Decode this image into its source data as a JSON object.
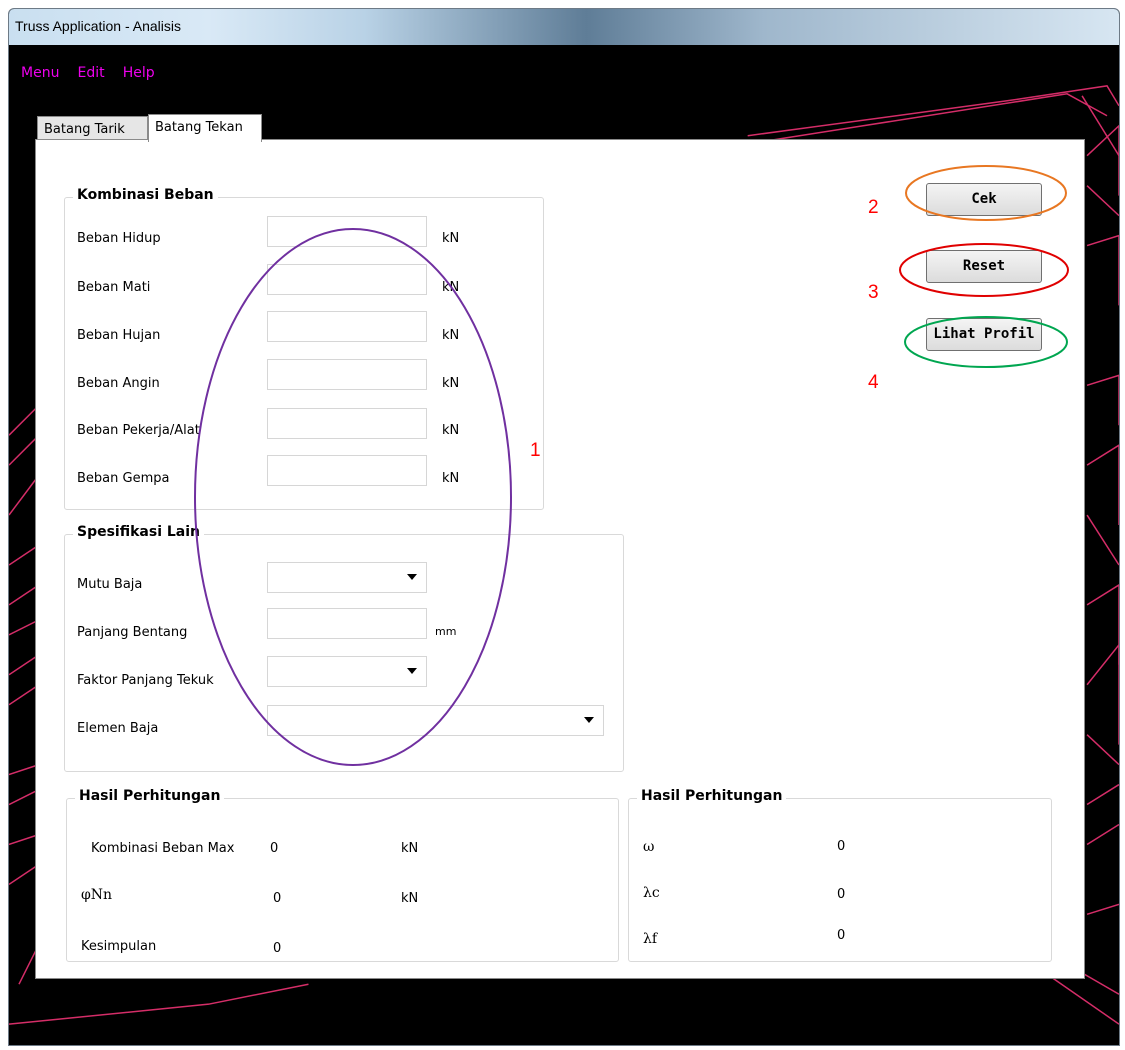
{
  "window": {
    "title": "Truss Application - Analisis"
  },
  "menu": [
    "Menu",
    "Edit",
    "Help"
  ],
  "tabs": [
    {
      "label": "Batang Tarik",
      "active": false
    },
    {
      "label": "Batang Tekan",
      "active": true
    }
  ],
  "kombinasi_beban": {
    "title": "Kombinasi Beban",
    "rows": [
      {
        "label": "Beban Hidup",
        "unit": "kN",
        "value": ""
      },
      {
        "label": "Beban Mati",
        "unit": "kN",
        "value": ""
      },
      {
        "label": "Beban Hujan",
        "unit": "kN",
        "value": ""
      },
      {
        "label": "Beban Angin",
        "unit": "kN",
        "value": ""
      },
      {
        "label": "Beban Pekerja/Alat",
        "unit": "kN",
        "value": ""
      },
      {
        "label": "Beban Gempa",
        "unit": "kN",
        "value": ""
      }
    ]
  },
  "spesifikasi_lain": {
    "title": "Spesifikasi Lain",
    "mutu_baja": {
      "label": "Mutu Baja",
      "value": ""
    },
    "panjang_bentang": {
      "label": "Panjang Bentang",
      "unit": "mm",
      "value": ""
    },
    "faktor_panjang_tekuk": {
      "label": "Faktor Panjang Tekuk",
      "value": ""
    },
    "elemen_baja": {
      "label": "Elemen Baja",
      "value": ""
    }
  },
  "hasil_left": {
    "title": "Hasil Perhitungan",
    "kombinasi_max": {
      "label": "Kombinasi Beban Max",
      "value": "0",
      "unit": "kN"
    },
    "phi_nn": {
      "label": "φNn",
      "value": "0",
      "unit": "kN"
    },
    "kesimpulan": {
      "label": "Kesimpulan",
      "value": "0"
    }
  },
  "hasil_right": {
    "title": "Hasil Perhitungan",
    "omega": {
      "label": "ω",
      "value": "0"
    },
    "lambda_c": {
      "label": "λc",
      "value": "0"
    },
    "lambda_f": {
      "label": "λf",
      "value": "0"
    }
  },
  "buttons": {
    "cek": "Cek",
    "reset": "Reset",
    "lihat_profil": "Lihat Profil"
  },
  "annotations": {
    "labels": [
      "1",
      "2",
      "3",
      "4"
    ],
    "colors": {
      "ellipse1": "#7030a0",
      "cek": "#e87722",
      "reset": "#e00000",
      "lihat": "#00a650",
      "numbers": "#ff0000"
    }
  },
  "theme": {
    "menu_color": "#ee00ee",
    "decor_color": "#e0306e"
  }
}
